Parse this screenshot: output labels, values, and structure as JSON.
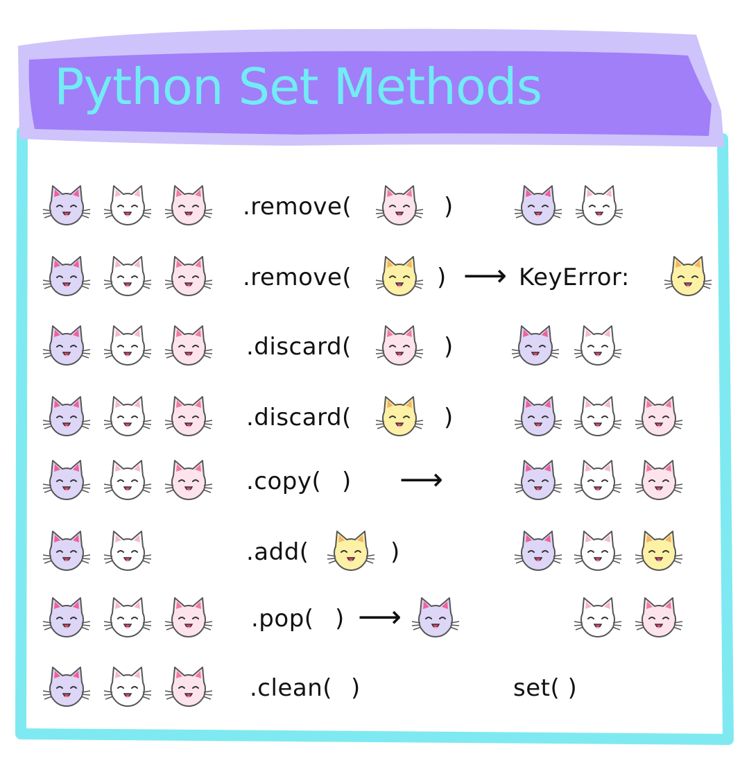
{
  "title": "Python Set Methods",
  "colors": {
    "header_fill": "#a07ff9",
    "header_border": "#cfc3fb",
    "title_text": "#72ecf4",
    "frame_border": "#7fe9f1",
    "cat_purple": "#ddd6f6",
    "cat_white": "#ffffff",
    "cat_pink": "#fde4ec",
    "cat_yellow": "#fdf1a6"
  },
  "rows": [
    {
      "inputs": [
        "purple",
        "white",
        "pink"
      ],
      "method": ".remove(",
      "arg": "pink",
      "close": ")",
      "arrow": "",
      "result_text": "",
      "result_cats": [
        "purple",
        "white"
      ],
      "popped": ""
    },
    {
      "inputs": [
        "purple",
        "white",
        "pink"
      ],
      "method": ".remove(",
      "arg": "yellow",
      "close": ")",
      "arrow": "⟶",
      "result_text": "KeyError:",
      "result_cats": [
        "yellow"
      ],
      "popped": ""
    },
    {
      "inputs": [
        "purple",
        "white",
        "pink"
      ],
      "method": ".discard(",
      "arg": "pink",
      "close": ")",
      "arrow": "",
      "result_text": "",
      "result_cats": [
        "purple",
        "white"
      ],
      "popped": ""
    },
    {
      "inputs": [
        "purple",
        "white",
        "pink"
      ],
      "method": ".discard(",
      "arg": "yellow",
      "close": ")",
      "arrow": "",
      "result_text": "",
      "result_cats": [
        "purple",
        "white",
        "pink"
      ],
      "popped": ""
    },
    {
      "inputs": [
        "purple",
        "white",
        "pink"
      ],
      "method": ".copy(",
      "arg": "",
      "close": ")",
      "arrow": "⟶",
      "result_text": "",
      "result_cats": [
        "purple",
        "white",
        "pink"
      ],
      "popped": ""
    },
    {
      "inputs": [
        "purple",
        "white"
      ],
      "method": ".add(",
      "arg": "yellow",
      "close": ")",
      "arrow": "",
      "result_text": "",
      "result_cats": [
        "purple",
        "white",
        "yellow"
      ],
      "popped": ""
    },
    {
      "inputs": [
        "purple",
        "white",
        "pink"
      ],
      "method": ".pop(",
      "arg": "",
      "close": ")",
      "arrow": "⟶",
      "result_text": "",
      "result_cats": [
        "white",
        "pink"
      ],
      "popped": "purple"
    },
    {
      "inputs": [
        "purple",
        "white",
        "pink"
      ],
      "method": ".clean(",
      "arg": "",
      "close": ")",
      "arrow": "",
      "result_text": "set(  )",
      "result_cats": [],
      "popped": ""
    }
  ]
}
